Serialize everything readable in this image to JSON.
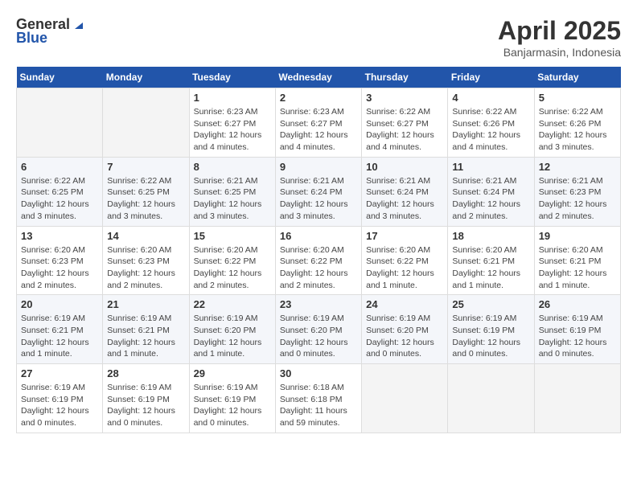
{
  "header": {
    "logo_general": "General",
    "logo_blue": "Blue",
    "title": "April 2025",
    "subtitle": "Banjarmasin, Indonesia"
  },
  "weekdays": [
    "Sunday",
    "Monday",
    "Tuesday",
    "Wednesday",
    "Thursday",
    "Friday",
    "Saturday"
  ],
  "weeks": [
    [
      {
        "day": "",
        "sunrise": "",
        "sunset": "",
        "daylight": ""
      },
      {
        "day": "",
        "sunrise": "",
        "sunset": "",
        "daylight": ""
      },
      {
        "day": "1",
        "sunrise": "Sunrise: 6:23 AM",
        "sunset": "Sunset: 6:27 PM",
        "daylight": "Daylight: 12 hours and 4 minutes."
      },
      {
        "day": "2",
        "sunrise": "Sunrise: 6:23 AM",
        "sunset": "Sunset: 6:27 PM",
        "daylight": "Daylight: 12 hours and 4 minutes."
      },
      {
        "day": "3",
        "sunrise": "Sunrise: 6:22 AM",
        "sunset": "Sunset: 6:27 PM",
        "daylight": "Daylight: 12 hours and 4 minutes."
      },
      {
        "day": "4",
        "sunrise": "Sunrise: 6:22 AM",
        "sunset": "Sunset: 6:26 PM",
        "daylight": "Daylight: 12 hours and 4 minutes."
      },
      {
        "day": "5",
        "sunrise": "Sunrise: 6:22 AM",
        "sunset": "Sunset: 6:26 PM",
        "daylight": "Daylight: 12 hours and 3 minutes."
      }
    ],
    [
      {
        "day": "6",
        "sunrise": "Sunrise: 6:22 AM",
        "sunset": "Sunset: 6:25 PM",
        "daylight": "Daylight: 12 hours and 3 minutes."
      },
      {
        "day": "7",
        "sunrise": "Sunrise: 6:22 AM",
        "sunset": "Sunset: 6:25 PM",
        "daylight": "Daylight: 12 hours and 3 minutes."
      },
      {
        "day": "8",
        "sunrise": "Sunrise: 6:21 AM",
        "sunset": "Sunset: 6:25 PM",
        "daylight": "Daylight: 12 hours and 3 minutes."
      },
      {
        "day": "9",
        "sunrise": "Sunrise: 6:21 AM",
        "sunset": "Sunset: 6:24 PM",
        "daylight": "Daylight: 12 hours and 3 minutes."
      },
      {
        "day": "10",
        "sunrise": "Sunrise: 6:21 AM",
        "sunset": "Sunset: 6:24 PM",
        "daylight": "Daylight: 12 hours and 3 minutes."
      },
      {
        "day": "11",
        "sunrise": "Sunrise: 6:21 AM",
        "sunset": "Sunset: 6:24 PM",
        "daylight": "Daylight: 12 hours and 2 minutes."
      },
      {
        "day": "12",
        "sunrise": "Sunrise: 6:21 AM",
        "sunset": "Sunset: 6:23 PM",
        "daylight": "Daylight: 12 hours and 2 minutes."
      }
    ],
    [
      {
        "day": "13",
        "sunrise": "Sunrise: 6:20 AM",
        "sunset": "Sunset: 6:23 PM",
        "daylight": "Daylight: 12 hours and 2 minutes."
      },
      {
        "day": "14",
        "sunrise": "Sunrise: 6:20 AM",
        "sunset": "Sunset: 6:23 PM",
        "daylight": "Daylight: 12 hours and 2 minutes."
      },
      {
        "day": "15",
        "sunrise": "Sunrise: 6:20 AM",
        "sunset": "Sunset: 6:22 PM",
        "daylight": "Daylight: 12 hours and 2 minutes."
      },
      {
        "day": "16",
        "sunrise": "Sunrise: 6:20 AM",
        "sunset": "Sunset: 6:22 PM",
        "daylight": "Daylight: 12 hours and 2 minutes."
      },
      {
        "day": "17",
        "sunrise": "Sunrise: 6:20 AM",
        "sunset": "Sunset: 6:22 PM",
        "daylight": "Daylight: 12 hours and 1 minute."
      },
      {
        "day": "18",
        "sunrise": "Sunrise: 6:20 AM",
        "sunset": "Sunset: 6:21 PM",
        "daylight": "Daylight: 12 hours and 1 minute."
      },
      {
        "day": "19",
        "sunrise": "Sunrise: 6:20 AM",
        "sunset": "Sunset: 6:21 PM",
        "daylight": "Daylight: 12 hours and 1 minute."
      }
    ],
    [
      {
        "day": "20",
        "sunrise": "Sunrise: 6:19 AM",
        "sunset": "Sunset: 6:21 PM",
        "daylight": "Daylight: 12 hours and 1 minute."
      },
      {
        "day": "21",
        "sunrise": "Sunrise: 6:19 AM",
        "sunset": "Sunset: 6:21 PM",
        "daylight": "Daylight: 12 hours and 1 minute."
      },
      {
        "day": "22",
        "sunrise": "Sunrise: 6:19 AM",
        "sunset": "Sunset: 6:20 PM",
        "daylight": "Daylight: 12 hours and 1 minute."
      },
      {
        "day": "23",
        "sunrise": "Sunrise: 6:19 AM",
        "sunset": "Sunset: 6:20 PM",
        "daylight": "Daylight: 12 hours and 0 minutes."
      },
      {
        "day": "24",
        "sunrise": "Sunrise: 6:19 AM",
        "sunset": "Sunset: 6:20 PM",
        "daylight": "Daylight: 12 hours and 0 minutes."
      },
      {
        "day": "25",
        "sunrise": "Sunrise: 6:19 AM",
        "sunset": "Sunset: 6:19 PM",
        "daylight": "Daylight: 12 hours and 0 minutes."
      },
      {
        "day": "26",
        "sunrise": "Sunrise: 6:19 AM",
        "sunset": "Sunset: 6:19 PM",
        "daylight": "Daylight: 12 hours and 0 minutes."
      }
    ],
    [
      {
        "day": "27",
        "sunrise": "Sunrise: 6:19 AM",
        "sunset": "Sunset: 6:19 PM",
        "daylight": "Daylight: 12 hours and 0 minutes."
      },
      {
        "day": "28",
        "sunrise": "Sunrise: 6:19 AM",
        "sunset": "Sunset: 6:19 PM",
        "daylight": "Daylight: 12 hours and 0 minutes."
      },
      {
        "day": "29",
        "sunrise": "Sunrise: 6:19 AM",
        "sunset": "Sunset: 6:19 PM",
        "daylight": "Daylight: 12 hours and 0 minutes."
      },
      {
        "day": "30",
        "sunrise": "Sunrise: 6:18 AM",
        "sunset": "Sunset: 6:18 PM",
        "daylight": "Daylight: 11 hours and 59 minutes."
      },
      {
        "day": "",
        "sunrise": "",
        "sunset": "",
        "daylight": ""
      },
      {
        "day": "",
        "sunrise": "",
        "sunset": "",
        "daylight": ""
      },
      {
        "day": "",
        "sunrise": "",
        "sunset": "",
        "daylight": ""
      }
    ]
  ]
}
